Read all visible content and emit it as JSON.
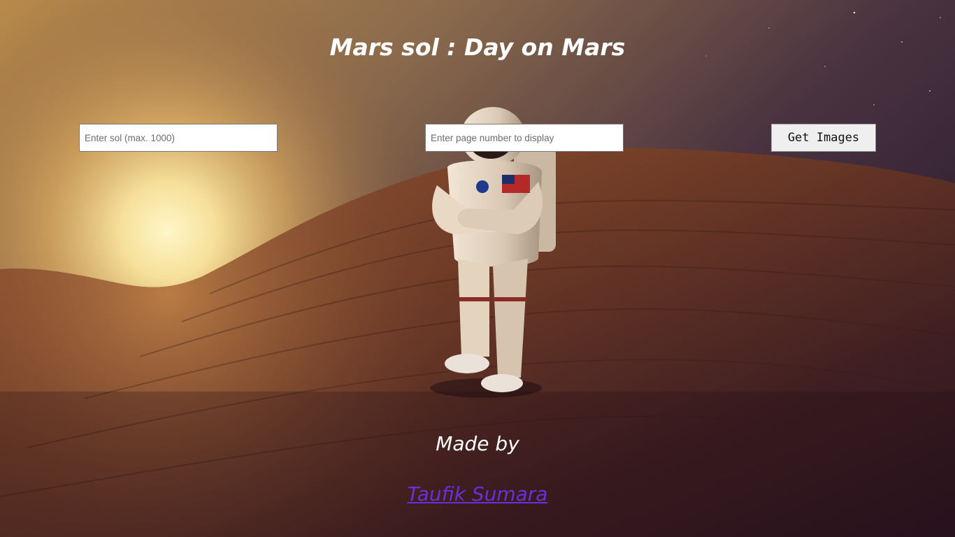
{
  "page": {
    "title": "Mars sol : Day on Mars"
  },
  "form": {
    "sol_placeholder": "Enter sol (max. 1000)",
    "page_placeholder": "Enter page number to display",
    "submit_label": "Get Images"
  },
  "footer": {
    "made_by": "Made by",
    "author": "Taufik Sumara"
  },
  "colors": {
    "title_text": "#ffffff",
    "link": "#6a2fd8",
    "sky_glow": "#f6e3a0",
    "terrain": "#7a4426"
  },
  "background": {
    "scene": "astronaut standing on martian hill at sunrise",
    "icon": "astronaut-icon"
  }
}
